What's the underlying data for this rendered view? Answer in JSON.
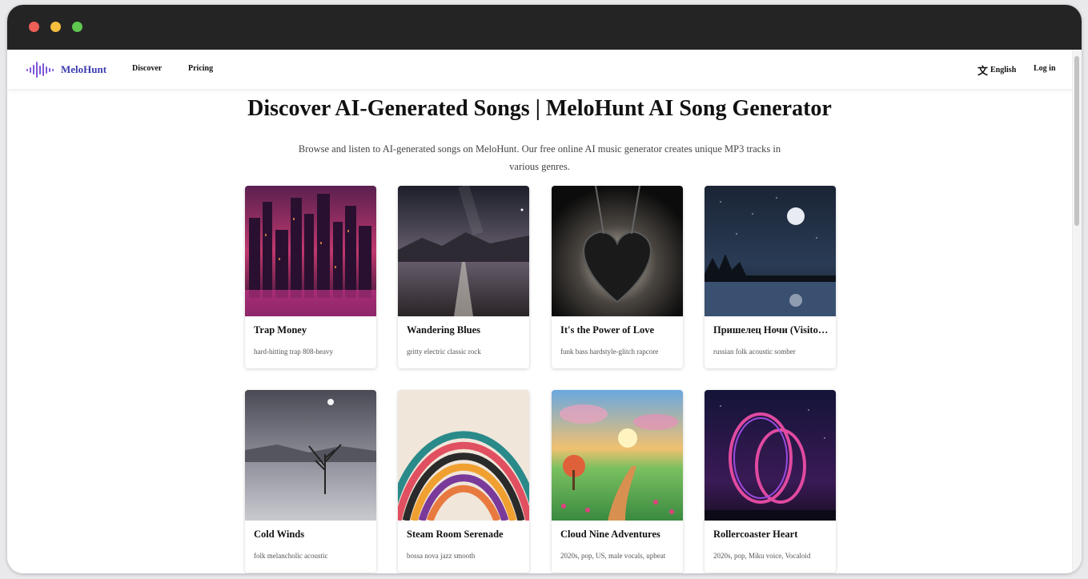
{
  "app": {
    "brand": "MeloHunt"
  },
  "nav": {
    "links": [
      {
        "label": "Discover"
      },
      {
        "label": "Pricing"
      }
    ],
    "language": "English",
    "login": "Log in"
  },
  "header": {
    "title": "Discover AI-Generated Songs | MeloHunt AI Song Generator",
    "subtitle": "Browse and listen to AI-generated songs on MeloHunt. Our free online AI music generator creates unique MP3 tracks in various genres."
  },
  "songs": [
    {
      "title": "Trap Money",
      "tags": "hard-hitting trap 808-heavy"
    },
    {
      "title": "Wandering Blues",
      "tags": "gritty electric classic rock"
    },
    {
      "title": "It's the Power of Love",
      "tags": "funk bass hardstyle-glitch rapcore"
    },
    {
      "title": "Пришелец Ночи (Visitor of the Night)",
      "tags": "russian folk acoustic somber"
    },
    {
      "title": "Cold Winds",
      "tags": "folk melancholic acoustic"
    },
    {
      "title": "Steam Room Serenade",
      "tags": "bossa nova jazz smooth"
    },
    {
      "title": "Cloud Nine Adventures",
      "tags": "2020s, pop, US, male vocals, upbeat"
    },
    {
      "title": "Rollercoaster Heart",
      "tags": "2020s, pop, Miku voice, Vocaloid"
    }
  ],
  "icons": {
    "language": "translate-icon",
    "logo": "soundwave-logo-icon"
  },
  "colors": {
    "brand": "#3b3bb0",
    "titlebar": "#242424"
  }
}
